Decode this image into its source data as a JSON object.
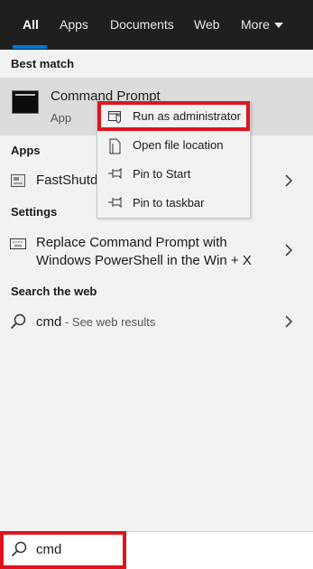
{
  "tabs": [
    "All",
    "Apps",
    "Documents",
    "Web",
    "More"
  ],
  "sections": {
    "best_match": "Best match",
    "apps": "Apps",
    "settings": "Settings",
    "search_web": "Search the web"
  },
  "best_match_item": {
    "title": "Command Prompt",
    "subtitle": "App"
  },
  "apps_item": {
    "label": "FastShutd"
  },
  "settings_item": {
    "line1": "Replace Command Prompt with",
    "line2": "Windows PowerShell in the Win + X"
  },
  "web_item": {
    "query": "cmd",
    "suffix": " - See web results"
  },
  "context_menu": {
    "items": [
      "Run as administrator",
      "Open file location",
      "Pin to Start",
      "Pin to taskbar"
    ]
  },
  "search": {
    "value": "cmd"
  },
  "colors": {
    "accent": "#0078d7",
    "highlight_box": "#e0141e",
    "topbar": "#1f1f1f"
  }
}
